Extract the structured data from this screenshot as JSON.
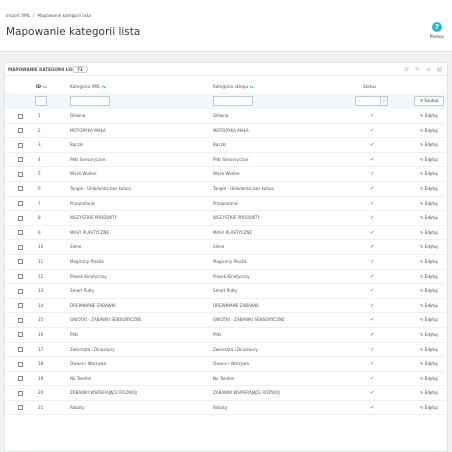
{
  "breadcrumb": {
    "parent": "Import XML",
    "current": "Mapowanie kategorii lista"
  },
  "page_title": "Mapowanie kategorii lista",
  "help": {
    "icon": "help-circle-icon",
    "label": "Pomoc"
  },
  "panel": {
    "title": "MAPOWANIE KATEGORII LISTA",
    "count": "71",
    "icons": [
      "add-icon",
      "refresh-icon",
      "sql-icon",
      "export-icon"
    ]
  },
  "columns": {
    "id": "ID",
    "xml": "Kategoria XML",
    "shop": "Kategoria sklepu",
    "status": "Status"
  },
  "filter": {
    "dash": "-",
    "status_value": "-",
    "search_label": "Szukaj"
  },
  "row_edit_label": "Edytuj",
  "status_color": "#72c279",
  "accent_color": "#25b9d7",
  "rows": [
    {
      "id": "1",
      "xml": "Główna",
      "shop": "Główna"
    },
    {
      "id": "2",
      "xml": "MOTORYKA MAŁA",
      "shop": "MOTORYKA MAŁA"
    },
    {
      "id": "3",
      "xml": "Bączki",
      "shop": "Bączki"
    },
    {
      "id": "4",
      "xml": "Piłki Sensoryczne",
      "shop": "Piłki Sensoryczne"
    },
    {
      "id": "5",
      "xml": "Węże Wodne",
      "shop": "Węże Wodne"
    },
    {
      "id": "6",
      "xml": "Tangle - Układanka bez końca",
      "shop": "Tangle - Układanka bez końca"
    },
    {
      "id": "7",
      "xml": "Przeplatanki",
      "shop": "Przeplatanki"
    },
    {
      "id": "8",
      "xml": "WSZYSTKIE PRODUKTY",
      "shop": "WSZYSTKIE PRODUKTY"
    },
    {
      "id": "9",
      "xml": "MASY PLASTYCZNE",
      "shop": "MASY PLASTYCZNE"
    },
    {
      "id": "10",
      "xml": "Slime",
      "shop": "Slime"
    },
    {
      "id": "11",
      "xml": "Magiczny Plastik",
      "shop": "Magiczny Plastik"
    },
    {
      "id": "12",
      "xml": "Piasek Kinetyczny",
      "shop": "Piasek Kinetyczny"
    },
    {
      "id": "13",
      "xml": "Smart Putty",
      "shop": "Smart Putty"
    },
    {
      "id": "14",
      "xml": "DREWNIANE ZABAWKI",
      "shop": "DREWNIANE ZABAWKI"
    },
    {
      "id": "15",
      "xml": "GNIOTKI - ZABAWKI SENSORYCZNE",
      "shop": "GNIOTKI - ZABAWKI SENSORYCZNE"
    },
    {
      "id": "16",
      "xml": "Piłki",
      "shop": "Piłki"
    },
    {
      "id": "17",
      "xml": "Zwierzęta i Dinozaury",
      "shop": "Zwierzęta i Dinozaury"
    },
    {
      "id": "18",
      "xml": "Owoce i Warzywa",
      "shop": "Owoce i Warzywa"
    },
    {
      "id": "19",
      "xml": "Na Telefon",
      "shop": "Na Telefon"
    },
    {
      "id": "20",
      "xml": "ZABAWKI WSPIERAJĄCE ROZWÓJ",
      "shop": "ZABAWKI WSPIERAJĄCE ROZWÓJ"
    },
    {
      "id": "21",
      "xml": "Roboty",
      "shop": "Roboty"
    }
  ]
}
